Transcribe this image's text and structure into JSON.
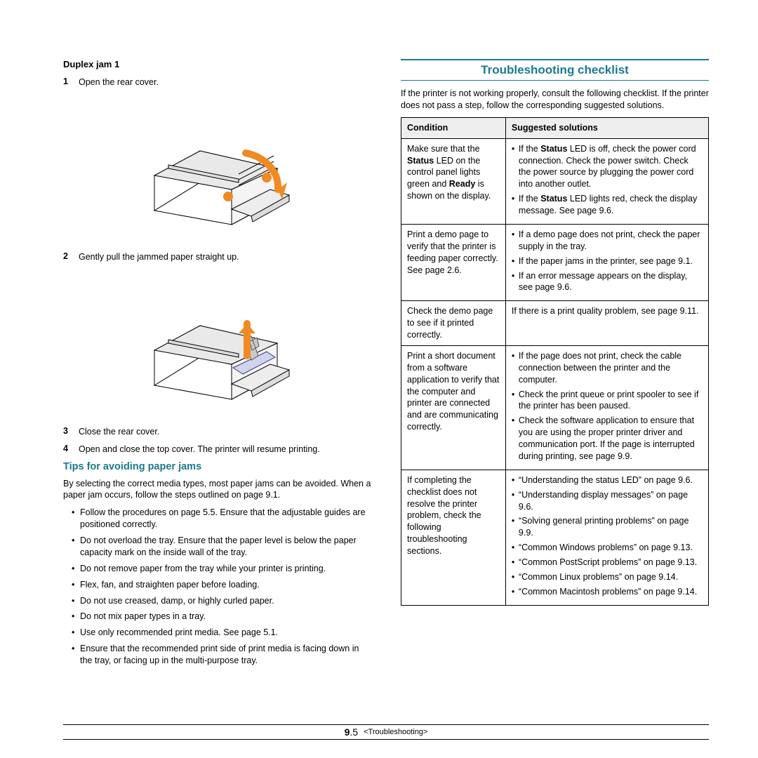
{
  "left": {
    "heading": "Duplex jam 1",
    "steps_a": [
      {
        "n": "1",
        "t": "Open the rear cover."
      }
    ],
    "steps_b": [
      {
        "n": "2",
        "t": "Gently pull the jammed paper straight up."
      }
    ],
    "steps_c": [
      {
        "n": "3",
        "t": "Close the rear cover."
      },
      {
        "n": "4",
        "t": "Open and close the top cover. The printer will resume printing."
      }
    ],
    "tips_heading": "Tips for avoiding paper jams",
    "tips_intro": "By selecting the correct media types, most paper jams can be avoided. When a paper jam occurs, follow the steps outlined on page 9.1.",
    "tips": [
      "Follow the procedures on page 5.5. Ensure that the adjustable guides are positioned correctly.",
      "Do not overload the tray. Ensure that the paper level is below the paper capacity mark on the inside wall of the tray.",
      "Do not remove paper from the tray while your printer is printing.",
      "Flex, fan, and straighten paper before loading.",
      "Do not use creased, damp, or highly curled paper.",
      "Do not mix paper types in a tray.",
      "Use only recommended print media. See page 5.1.",
      "Ensure that the recommended print side of print media is facing down in the tray, or facing up in the multi-purpose tray."
    ]
  },
  "right": {
    "title": "Troubleshooting checklist",
    "intro": "If the printer is not working properly, consult the following checklist. If the printer does not pass a step, follow the corresponding suggested solutions.",
    "th1": "Condition",
    "th2": "Suggested solutions"
  },
  "chart_data": {
    "type": "table",
    "title": "Troubleshooting checklist",
    "columns": [
      "Condition",
      "Suggested solutions"
    ],
    "rows": [
      {
        "condition": "Make sure that the Status LED on the control panel lights green and Ready is shown on the display.",
        "solutions": [
          "If the Status LED is off, check the power cord connection. Check the power switch. Check the power source by plugging the power cord into another outlet.",
          "If the Status LED lights red, check the display message. See page 9.6."
        ]
      },
      {
        "condition": "Print a demo page to verify that the printer is feeding paper correctly. See page 2.6.",
        "solutions": [
          "If a demo page does not print, check the paper supply in the tray.",
          "If the paper jams in the printer, see page 9.1.",
          "If an error message appears on the display, see page 9.6."
        ]
      },
      {
        "condition": "Check the demo page to see if it printed correctly.",
        "solutions_text": "If there is a print quality problem, see page 9.11."
      },
      {
        "condition": "Print a short document from a software application to verify that the computer and printer are connected and are communicating correctly.",
        "solutions": [
          "If the page does not print, check the cable connection between the printer and the computer.",
          "Check the print queue or print spooler to see if the printer has been paused.",
          "Check the software application to ensure that you are using the proper printer driver and communication port. If the page is interrupted during printing, see page 9.9."
        ]
      },
      {
        "condition": "If completing the checklist does not resolve the printer problem, check the following troubleshooting sections.",
        "solutions": [
          "“Understanding the status LED” on page 9.6.",
          "“Understanding display messages” on page 9.6.",
          "“Solving general printing problems” on page 9.9.",
          "“Common Windows problems” on page 9.13.",
          "“Common PostScript problems” on page 9.13.",
          "“Common Linux problems” on page 9.14.",
          "“Common Macintosh problems” on page 9.14."
        ]
      }
    ]
  },
  "footer": {
    "page": "9.5",
    "label": "<Troubleshooting>"
  }
}
